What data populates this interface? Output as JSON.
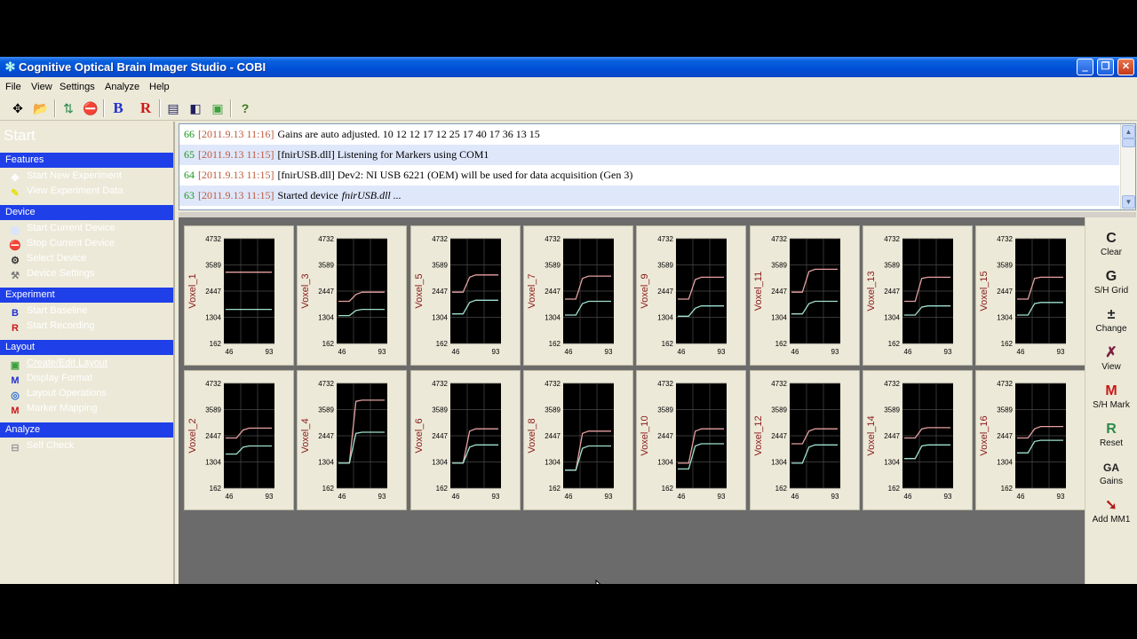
{
  "window": {
    "title": "Cognitive Optical Brain Imager Studio - COBI",
    "controls": {
      "minimize": "‗",
      "maximize": "❐",
      "close": "✕"
    }
  },
  "menu": {
    "items": [
      "File",
      "View",
      "Settings",
      "Analyze",
      "Help"
    ]
  },
  "toolbar": {
    "buttons": [
      {
        "icon": "layout-grid-icon",
        "glyph": "✥"
      },
      {
        "icon": "open-folder-icon",
        "glyph": "📂"
      },
      {
        "icon": "start-device-icon",
        "glyph": "⇅"
      },
      {
        "icon": "stop-icon",
        "glyph": "⛔"
      },
      {
        "icon": "baseline-icon",
        "glyph": "B"
      },
      {
        "icon": "record-icon",
        "glyph": "R"
      },
      {
        "icon": "display-format-icon",
        "glyph": "▤"
      },
      {
        "icon": "layout-icon",
        "glyph": "◧"
      },
      {
        "icon": "image-icon",
        "glyph": "▣"
      },
      {
        "icon": "help-icon",
        "glyph": "?"
      }
    ]
  },
  "sidebar": {
    "title": "Start",
    "sections": [
      {
        "header": "Features",
        "items": [
          {
            "label": "Start New Experiment",
            "icon": "new-experiment-icon",
            "glyph": "✥",
            "color": "#ffffff"
          },
          {
            "label": "View Experiment Data",
            "icon": "view-data-icon",
            "glyph": "✎",
            "color": "#e8e000"
          }
        ]
      },
      {
        "header": "Device",
        "items": [
          {
            "label": "Start Current Device",
            "icon": "start-device-icon",
            "glyph": "▦",
            "color": "#d8e4ff"
          },
          {
            "label": "Stop Current Device",
            "icon": "stop-device-icon",
            "glyph": "⛔",
            "color": "#e8202a"
          },
          {
            "label": "Select Device",
            "icon": "select-device-icon",
            "glyph": "⚙",
            "color": "#333333"
          },
          {
            "label": "Device Settings",
            "icon": "device-settings-icon",
            "glyph": "⚒",
            "color": "#777777"
          }
        ]
      },
      {
        "header": "Experiment",
        "items": [
          {
            "label": "Start Baseline",
            "icon": "baseline-icon",
            "glyph": "B",
            "color": "#2030d0"
          },
          {
            "label": "Start Recording",
            "icon": "record-icon",
            "glyph": "R",
            "color": "#d01818"
          }
        ]
      },
      {
        "header": "Layout",
        "items": [
          {
            "label": "Create/Edit Layout",
            "icon": "create-layout-icon",
            "glyph": "▣",
            "color": "#3ca03c",
            "underline": true
          },
          {
            "label": "Display Format",
            "icon": "display-format-icon",
            "glyph": "M",
            "color": "#2030d0"
          },
          {
            "label": "Layout Operations",
            "icon": "layout-operations-icon",
            "glyph": "◎",
            "color": "#2a6ad0"
          },
          {
            "label": "Marker Mapping",
            "icon": "marker-mapping-icon",
            "glyph": "M",
            "color": "#c81818"
          }
        ]
      },
      {
        "header": "Analyze",
        "items": [
          {
            "label": "Self Check",
            "icon": "self-check-icon",
            "glyph": "⊟",
            "color": "#9a9a9a"
          }
        ]
      }
    ]
  },
  "log": {
    "rows": [
      {
        "num": "66",
        "time": "[2011.9.13 11:16]",
        "message": "Gains are auto adjusted. 10 12 12 17 12 25 17 40 17 36 13 15",
        "italic": ""
      },
      {
        "num": "65",
        "time": "[2011.9.13 11:15]",
        "message": "[fnirUSB.dll] Listening for Markers using COM1",
        "italic": ""
      },
      {
        "num": "64",
        "time": "[2011.9.13 11:15]",
        "message": "[fnirUSB.dll] Dev2: NI USB 6221 (OEM) will be used for data acquisition (Gen 3)",
        "italic": ""
      },
      {
        "num": "63",
        "time": "[2011.9.13 11:15]",
        "message": "Started device",
        "italic": "fnirUSB.dll ..."
      }
    ]
  },
  "plots": {
    "y_ticks": [
      "4732",
      "3589",
      "2447",
      "1304",
      "162"
    ],
    "x_ticks": [
      "46",
      "93"
    ],
    "colors": {
      "background": "#000000",
      "grid": "#4a4a4a",
      "upper_trace": "#e6a0a0",
      "lower_trace": "#a0e0d0",
      "label": "#8a1a1a"
    },
    "panels": [
      {
        "label": "Voxel_1",
        "upper": [
          3270,
          3270,
          3270,
          3270,
          3270
        ],
        "lower": [
          1650,
          1650,
          1650,
          1650,
          1650
        ]
      },
      {
        "label": "Voxel_2",
        "upper": [
          2350,
          2350,
          2700,
          2780,
          2780
        ],
        "lower": [
          1650,
          1650,
          1950,
          2000,
          2000
        ]
      },
      {
        "label": "Voxel_3",
        "upper": [
          2000,
          2000,
          2300,
          2400,
          2400
        ],
        "lower": [
          1380,
          1380,
          1600,
          1650,
          1650
        ]
      },
      {
        "label": "Voxel_4",
        "upper": [
          1250,
          1250,
          3950,
          4000,
          4000
        ],
        "lower": [
          1250,
          1250,
          2550,
          2600,
          2600
        ]
      },
      {
        "label": "Voxel_5",
        "upper": [
          2400,
          2400,
          3050,
          3150,
          3150
        ],
        "lower": [
          1450,
          1450,
          1950,
          2050,
          2050
        ]
      },
      {
        "label": "Voxel_6",
        "upper": [
          1250,
          1250,
          2650,
          2750,
          2750
        ],
        "lower": [
          1250,
          1250,
          1950,
          2050,
          2050
        ]
      },
      {
        "label": "Voxel_7",
        "upper": [
          2100,
          2100,
          3000,
          3100,
          3100
        ],
        "lower": [
          1400,
          1400,
          1900,
          2000,
          2000
        ]
      },
      {
        "label": "Voxel_8",
        "upper": [
          950,
          950,
          2550,
          2650,
          2650
        ],
        "lower": [
          950,
          950,
          1900,
          2000,
          2000
        ]
      },
      {
        "label": "Voxel_9",
        "upper": [
          2100,
          2100,
          2950,
          3050,
          3050
        ],
        "lower": [
          1350,
          1350,
          1700,
          1800,
          1800
        ]
      },
      {
        "label": "Voxel_10",
        "upper": [
          1250,
          1250,
          2650,
          2750,
          2750
        ],
        "lower": [
          1000,
          1000,
          2000,
          2100,
          2100
        ]
      },
      {
        "label": "Voxel_11",
        "upper": [
          2400,
          2400,
          3300,
          3400,
          3400
        ],
        "lower": [
          1450,
          1450,
          1900,
          2000,
          2000
        ]
      },
      {
        "label": "Voxel_12",
        "upper": [
          2100,
          2100,
          2650,
          2750,
          2750
        ],
        "lower": [
          1250,
          1250,
          1950,
          2050,
          2050
        ]
      },
      {
        "label": "Voxel_13",
        "upper": [
          2000,
          2000,
          3000,
          3050,
          3050
        ],
        "lower": [
          1400,
          1400,
          1750,
          1800,
          1800
        ]
      },
      {
        "label": "Voxel_14",
        "upper": [
          2350,
          2350,
          2750,
          2800,
          2800
        ],
        "lower": [
          1450,
          1450,
          2000,
          2050,
          2050
        ]
      },
      {
        "label": "Voxel_15",
        "upper": [
          2100,
          2100,
          3000,
          3050,
          3050
        ],
        "lower": [
          1400,
          1400,
          1900,
          1950,
          1950
        ]
      },
      {
        "label": "Voxel_16",
        "upper": [
          2350,
          2350,
          2750,
          2850,
          2850
        ],
        "lower": [
          1700,
          1700,
          2200,
          2250,
          2250
        ]
      }
    ]
  },
  "right_toolbar": {
    "buttons": [
      {
        "glyph": "C",
        "label": "Clear",
        "icon": "clear-icon",
        "color": "#222222"
      },
      {
        "glyph": "G",
        "label": "S/H Grid",
        "icon": "grid-icon",
        "color": "#222222"
      },
      {
        "glyph": "±",
        "label": "Change",
        "icon": "change-icon",
        "color": "#222222"
      },
      {
        "glyph": "✗",
        "label": "View",
        "icon": "view-icon",
        "color": "#7a2040"
      },
      {
        "glyph": "M",
        "label": "S/H Mark",
        "icon": "mark-icon",
        "color": "#c81818"
      },
      {
        "glyph": "R",
        "label": "Reset",
        "icon": "reset-icon",
        "color": "#2a8a4a"
      },
      {
        "glyph": "GA",
        "label": "Gains",
        "icon": "gains-icon",
        "color": "#222222"
      },
      {
        "glyph": "➘",
        "label": "Add MM1",
        "icon": "add-marker-icon",
        "color": "#b01818"
      }
    ]
  }
}
